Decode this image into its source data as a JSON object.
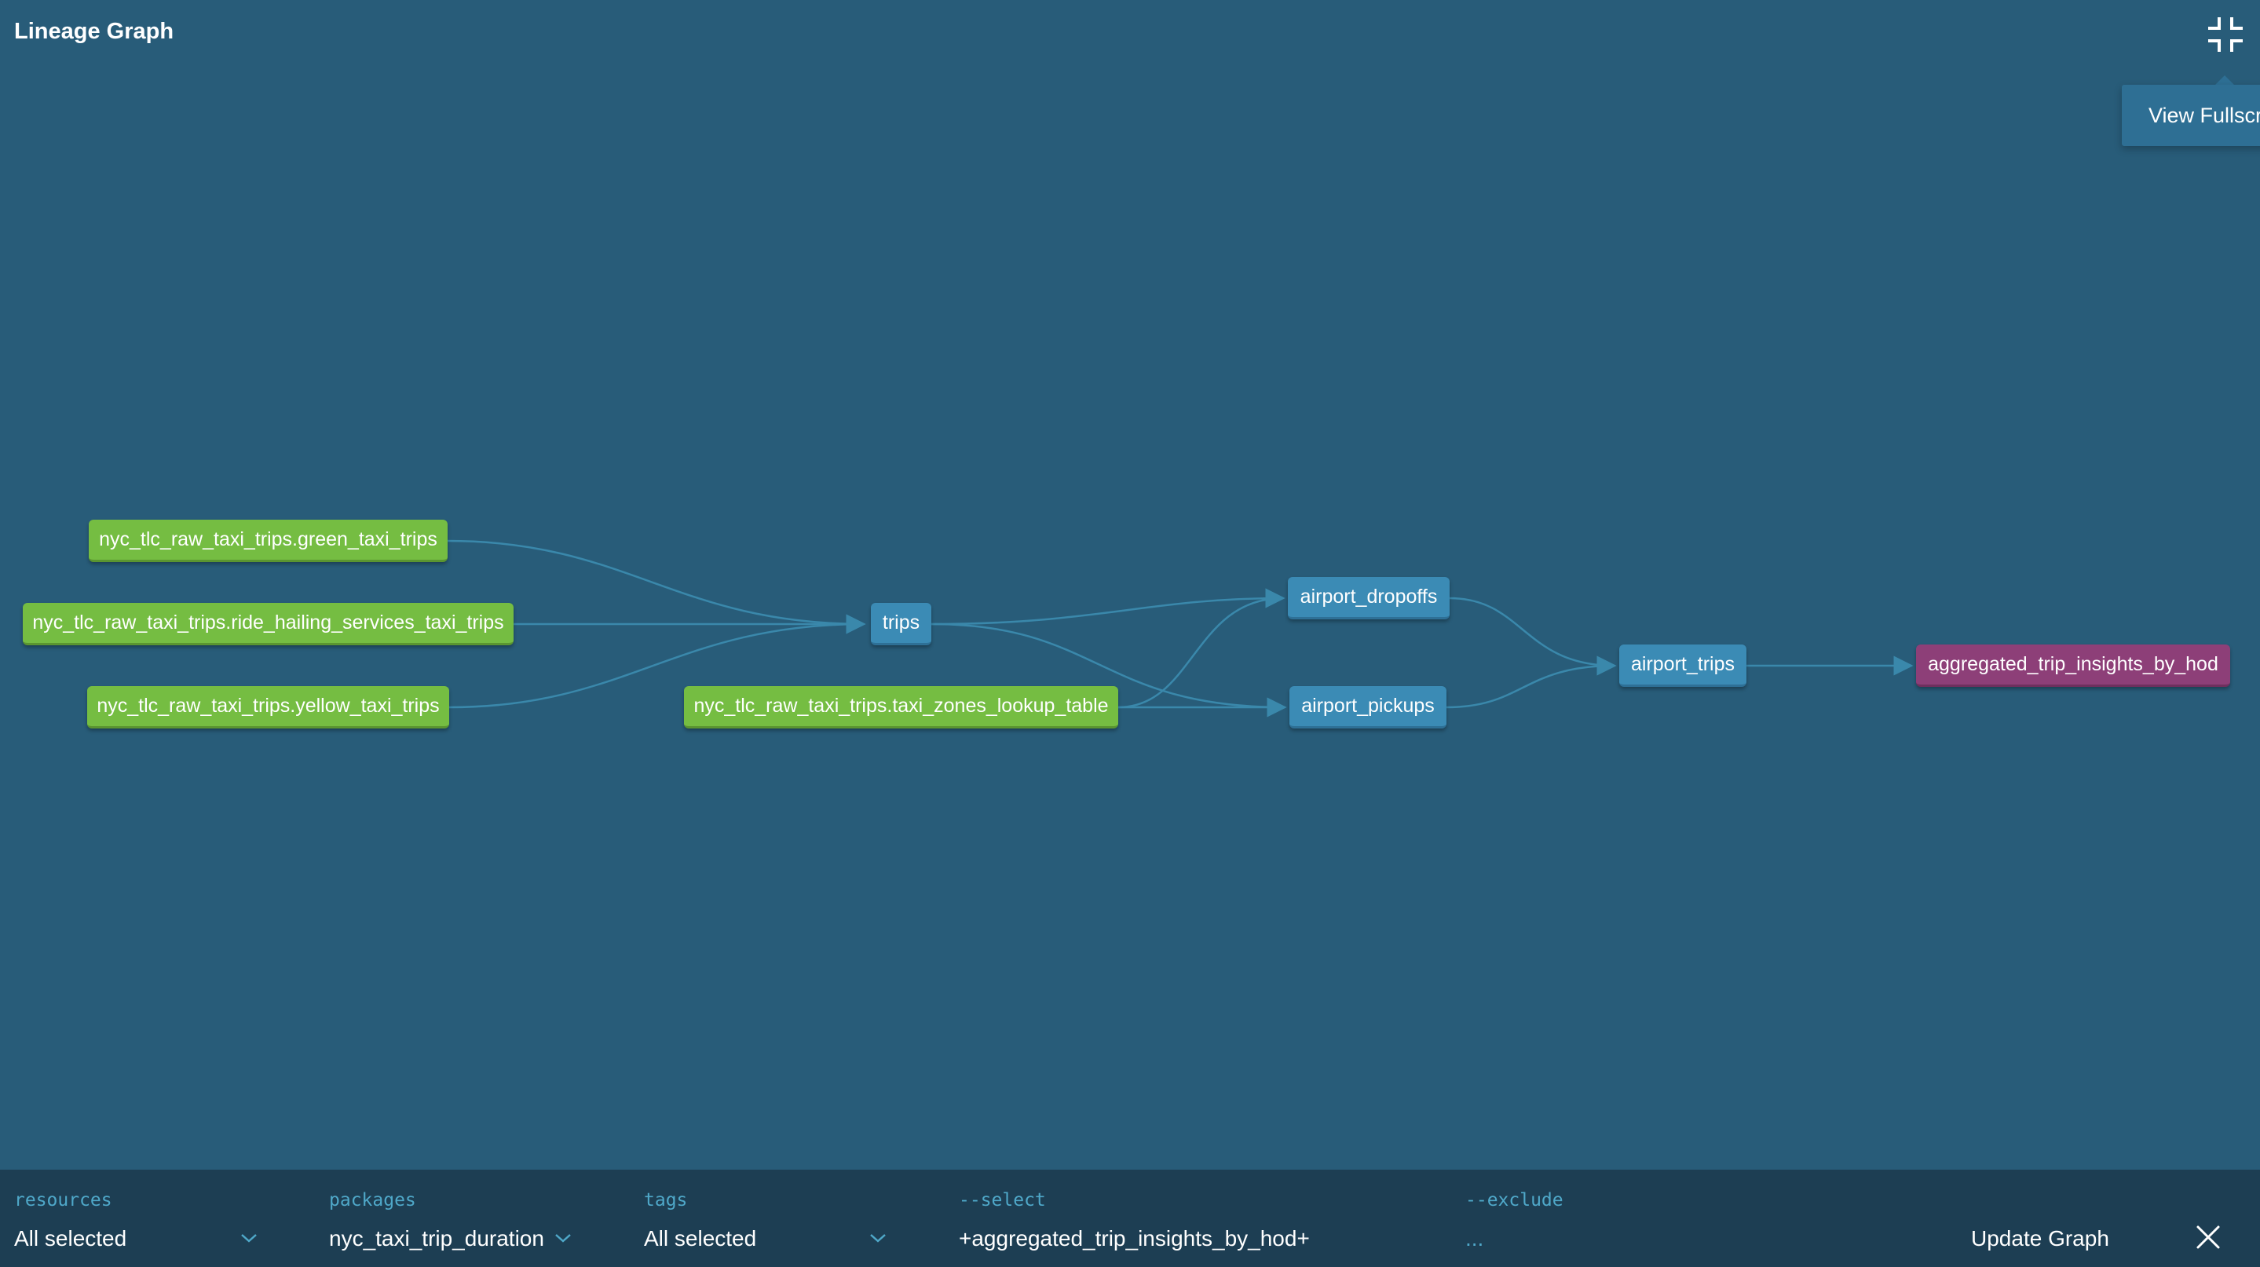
{
  "header": {
    "title": "Lineage Graph",
    "fullscreen_icon": "minimize-icon",
    "tooltip": "View Fullscreen"
  },
  "graph": {
    "nodes": {
      "green_taxi": "nyc_tlc_raw_taxi_trips.green_taxi_trips",
      "ride_hailing": "nyc_tlc_raw_taxi_trips.ride_hailing_services_taxi_trips",
      "yellow_taxi": "nyc_tlc_raw_taxi_trips.yellow_taxi_trips",
      "trips": "trips",
      "zones_lookup": "nyc_tlc_raw_taxi_trips.taxi_zones_lookup_table",
      "airport_dropoffs": "airport_dropoffs",
      "airport_pickups": "airport_pickups",
      "airport_trips": "airport_trips",
      "aggregated": "aggregated_trip_insights_by_hod"
    },
    "edges": [
      [
        "green_taxi",
        "trips"
      ],
      [
        "ride_hailing",
        "trips"
      ],
      [
        "yellow_taxi",
        "trips"
      ],
      [
        "trips",
        "airport_dropoffs"
      ],
      [
        "trips",
        "airport_pickups"
      ],
      [
        "zones_lookup",
        "airport_dropoffs"
      ],
      [
        "zones_lookup",
        "airport_pickups"
      ],
      [
        "airport_dropoffs",
        "airport_trips"
      ],
      [
        "airport_pickups",
        "airport_trips"
      ],
      [
        "airport_trips",
        "aggregated"
      ]
    ],
    "colors": {
      "source": "#75bd42",
      "model": "#3b8bb5",
      "selected": "#8d3f78",
      "edge": "#3a88ab"
    }
  },
  "filters": {
    "resources": {
      "label": "resources",
      "value": "All selected"
    },
    "packages": {
      "label": "packages",
      "value": "nyc_taxi_trip_duration"
    },
    "tags": {
      "label": "tags",
      "value": "All selected"
    },
    "select": {
      "label": "--select",
      "value": "+aggregated_trip_insights_by_hod+"
    },
    "exclude": {
      "label": "--exclude",
      "value": "..."
    },
    "update_label": "Update Graph",
    "close_icon": "close-icon"
  }
}
